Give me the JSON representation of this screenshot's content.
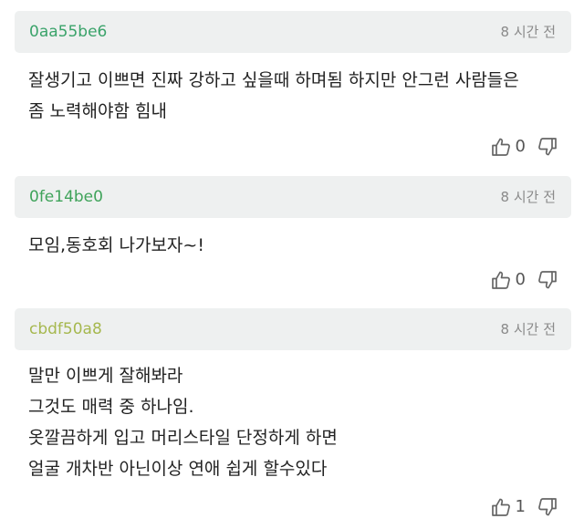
{
  "comments": [
    {
      "user": "0aa55be6",
      "user_color": "#3aa36a",
      "time": "8 시간 전",
      "lines": [
        "잘생기고 이쁘면 진짜 강하고 싶을때 하며됨 하지만 안그런 사람들은",
        "좀 노력해야함 힘내"
      ],
      "likes": "0"
    },
    {
      "user": "0fe14be0",
      "user_color": "#3fa35a",
      "time": "8 시간 전",
      "lines": [
        "모임,동호회 나가보자~!"
      ],
      "likes": "0"
    },
    {
      "user": "cbdf50a8",
      "user_color": "#a6b84f",
      "time": "8 시간 전",
      "lines": [
        "말만 이쁘게 잘해봐라",
        "그것도 매력 중 하나임.",
        "옷깔끔하게 입고 머리스타일 단정하게 하면",
        "얼굴 개차반 아닌이상 연애 쉽게 할수있다"
      ],
      "likes": "1"
    }
  ],
  "icons": {
    "like": "thumbs-up-icon",
    "dislike": "thumbs-down-icon"
  }
}
